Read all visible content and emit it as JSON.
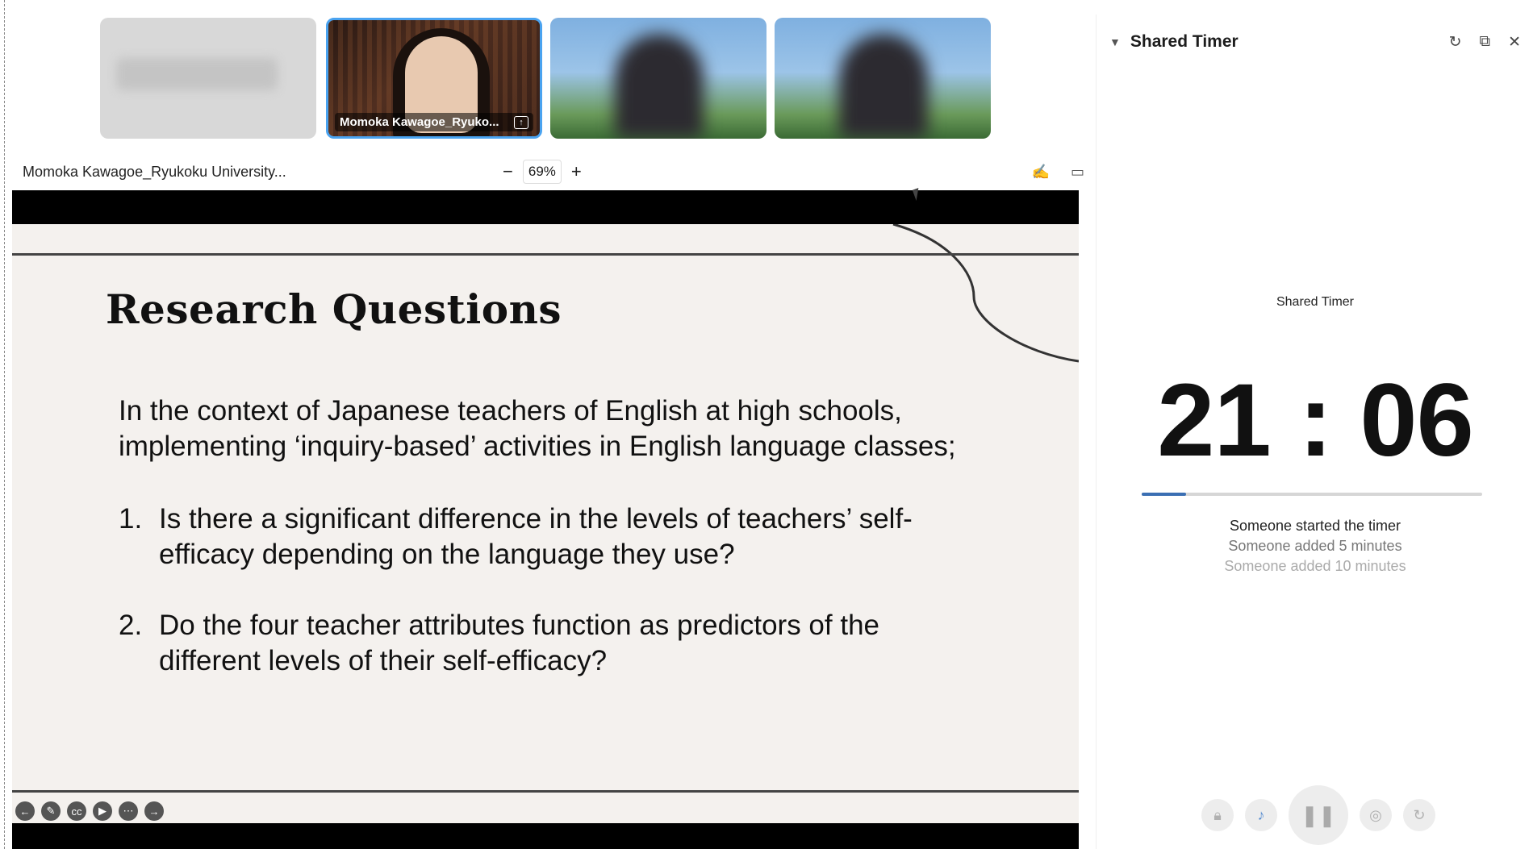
{
  "filmstrip": {
    "participants": [
      {
        "label": ""
      },
      {
        "label": "Momoka Kawagoe_Ryuko..."
      },
      {
        "label": ""
      },
      {
        "label": ""
      }
    ]
  },
  "toolbar": {
    "share_name": "Momoka Kawagoe_Ryukoku University...",
    "zoom_minus": "−",
    "zoom_value": "69%",
    "zoom_plus": "+"
  },
  "slide": {
    "title": "Research Questions",
    "intro": "In the context of Japanese teachers of English at high schools, implementing ‘inquiry-based’ activities in English language classes;",
    "questions": [
      {
        "num": "1.",
        "text": "Is there a significant difference in the levels of teachers’ self-efficacy depending on the language they use?"
      },
      {
        "num": "2.",
        "text": "Do the four teacher attributes function as predictors of the different levels of their self-efficacy?"
      }
    ]
  },
  "panel": {
    "title": "Shared Timer",
    "timer_label": "Shared Timer",
    "time": "21 : 06",
    "progress": 0.13,
    "accent": "#3b6fb3",
    "log": [
      "Someone started the timer",
      "Someone added 5 minutes",
      "Someone added 10 minutes"
    ]
  },
  "icons": {
    "collapse": "chevron-down-icon",
    "refresh": "refresh-icon",
    "popout": "popout-icon",
    "close": "close-icon"
  }
}
